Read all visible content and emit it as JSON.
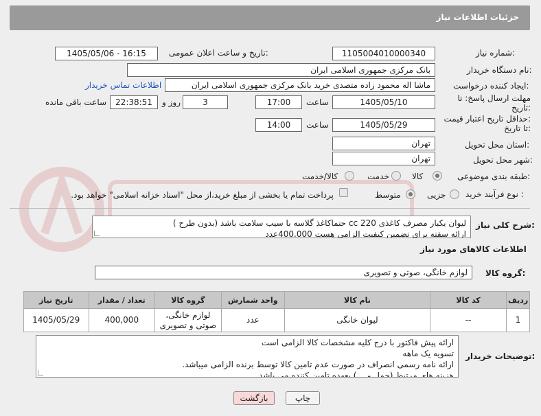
{
  "window": {
    "title": "جزئیات اطلاعات نیاز"
  },
  "form": {
    "need_number_label": "شماره نیاز:",
    "need_number": "1105004010000340",
    "announce_label": "تاریخ و ساعت اعلان عمومی:",
    "announce_value": "1405/05/06 - 16:15",
    "buyer_org_label": "نام دستگاه خریدار:",
    "buyer_org": "بانک مرکزی جمهوری اسلامی ایران",
    "creator_label": "ایجاد کننده درخواست:",
    "creator": "ماشا اله محمود زاده متصدی خرید بانک مرکزی جمهوری اسلامی ایران",
    "contact_link": "اطلاعات تماس خریدار",
    "deadline_label_1": "مهلت ارسال پاسخ: تا",
    "deadline_label_2": "تاریخ:",
    "deadline_date": "1405/05/10",
    "time_label": "ساعت",
    "deadline_time": "17:00",
    "days_value": "3",
    "days_label": "روز و",
    "remaining_time": "22:38:51",
    "remaining_label": "ساعت باقی مانده",
    "validity_label_1": "حداقل تاریخ اعتبار قیمت:",
    "validity_label_2": "تا تاریخ:",
    "validity_date": "1405/05/29",
    "validity_time": "14:00",
    "province_label": "استان محل تحویل:",
    "province": "تهران",
    "city_label": "شهر محل تحویل:",
    "city": "تهران",
    "category_label": "طبقه بندی موضوعی:",
    "category_options": [
      "کالا",
      "خدمت",
      "کالا/خدمت"
    ],
    "category_selected": "کالا",
    "process_label": "نوع فرآیند خرید :",
    "process_options": [
      "جزیی",
      "متوسط"
    ],
    "process_selected": "متوسط",
    "payment_note": "پرداخت تمام یا بخشی از مبلغ خرید،از محل \"اسناد خزانه اسلامی\" خواهد بود."
  },
  "description": {
    "label": "شرح کلی نیاز:",
    "lines": [
      "لیوان یکبار مصرف کاغذی  cc 220 حتماکاغذ گلاسه با سیب سلامت باشد (بدون طرح )",
      "ارائه سفته برای تضمین کیفیت الزامی هست 400.000عدد"
    ]
  },
  "goods": {
    "section_title": "اطلاعات کالاهای مورد نیاز",
    "group_label": "گروه کالا:",
    "group_value": "لوازم خانگی، صوتی و تصویری",
    "columns": [
      "ردیف",
      "کد کالا",
      "نام کالا",
      "واحد شمارش",
      "گروه کالا",
      "تعداد / مقدار",
      "تاریخ نیاز"
    ],
    "rows": [
      {
        "row": "1",
        "code": "--",
        "name": "لیوان خانگی",
        "unit": "عدد",
        "group_line1": "لوازم خانگی،",
        "group_line2": "صوتی و تصویری",
        "qty": "400,000",
        "date": "1405/05/29"
      }
    ]
  },
  "buyer_notes": {
    "label": "توضیحات خریدار:",
    "lines": [
      "ارائه پیش فاکتور با درج کلیه مشخصات کالا الزامی است",
      "تسویه یک ماهه",
      "ارائه نامه رسمی انصراف در صورت عدم تامین کالا توسط برنده الزامی میباشد.",
      "هزینه های مرتبط (حمل و ...) بعهده تامین کننده می باشد"
    ]
  },
  "buttons": {
    "print": "چاپ",
    "back": "بازگشت"
  },
  "colors": {
    "titlebar": "#9a9a9a",
    "link": "#1a56c4",
    "header_cell": "#c8c8c8",
    "back_button": "#f8d8d8"
  }
}
